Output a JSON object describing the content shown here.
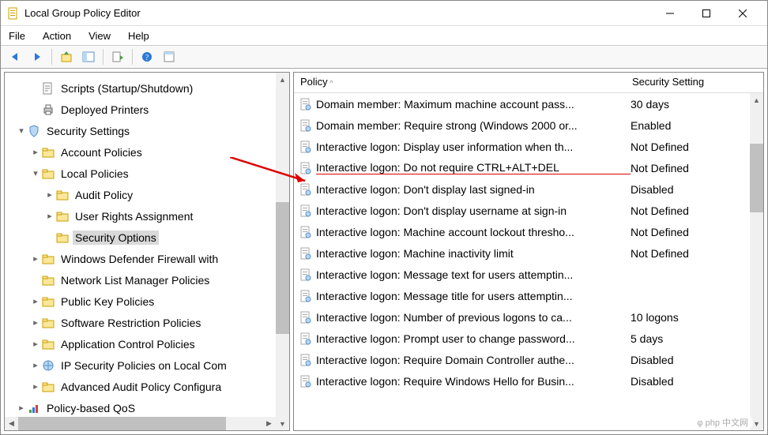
{
  "window": {
    "title": "Local Group Policy Editor"
  },
  "menubar": [
    "File",
    "Action",
    "View",
    "Help"
  ],
  "tree": [
    {
      "indent": 0,
      "chev": "",
      "icon": "script",
      "label": "Scripts (Startup/Shutdown)",
      "sel": false
    },
    {
      "indent": 0,
      "chev": "",
      "icon": "printer",
      "label": "Deployed Printers",
      "sel": false
    },
    {
      "indent": -1,
      "chev": "v",
      "icon": "shield",
      "label": "Security Settings",
      "sel": false
    },
    {
      "indent": 0,
      "chev": ">",
      "icon": "folder",
      "label": "Account Policies",
      "sel": false
    },
    {
      "indent": 0,
      "chev": "v",
      "icon": "folder",
      "label": "Local Policies",
      "sel": false
    },
    {
      "indent": 1,
      "chev": ">",
      "icon": "folder",
      "label": "Audit Policy",
      "sel": false
    },
    {
      "indent": 1,
      "chev": ">",
      "icon": "folder",
      "label": "User Rights Assignment",
      "sel": false
    },
    {
      "indent": 1,
      "chev": "",
      "icon": "folder",
      "label": "Security Options",
      "sel": true
    },
    {
      "indent": 0,
      "chev": ">",
      "icon": "folder",
      "label": "Windows Defender Firewall with",
      "sel": false
    },
    {
      "indent": 0,
      "chev": "",
      "icon": "folder",
      "label": "Network List Manager Policies",
      "sel": false
    },
    {
      "indent": 0,
      "chev": ">",
      "icon": "folder",
      "label": "Public Key Policies",
      "sel": false
    },
    {
      "indent": 0,
      "chev": ">",
      "icon": "folder",
      "label": "Software Restriction Policies",
      "sel": false
    },
    {
      "indent": 0,
      "chev": ">",
      "icon": "folder",
      "label": "Application Control Policies",
      "sel": false
    },
    {
      "indent": 0,
      "chev": ">",
      "icon": "ipsec",
      "label": "IP Security Policies on Local Com",
      "sel": false
    },
    {
      "indent": 0,
      "chev": ">",
      "icon": "folder",
      "label": "Advanced Audit Policy Configura",
      "sel": false
    },
    {
      "indent": -1,
      "chev": ">",
      "icon": "qos",
      "label": "Policy-based QoS",
      "sel": false
    }
  ],
  "list": {
    "columns": [
      "Policy",
      "Security Setting"
    ],
    "rows": [
      {
        "policy": "Domain member: Maximum machine account pass...",
        "setting": "30 days",
        "hl": false
      },
      {
        "policy": "Domain member: Require strong (Windows 2000 or...",
        "setting": "Enabled",
        "hl": false
      },
      {
        "policy": "Interactive logon: Display user information when th...",
        "setting": "Not Defined",
        "hl": false
      },
      {
        "policy": "Interactive logon: Do not require CTRL+ALT+DEL",
        "setting": "Not Defined",
        "hl": true
      },
      {
        "policy": "Interactive logon: Don't display last signed-in",
        "setting": "Disabled",
        "hl": false
      },
      {
        "policy": "Interactive logon: Don't display username at sign-in",
        "setting": "Not Defined",
        "hl": false
      },
      {
        "policy": "Interactive logon: Machine account lockout thresho...",
        "setting": "Not Defined",
        "hl": false
      },
      {
        "policy": "Interactive logon: Machine inactivity limit",
        "setting": "Not Defined",
        "hl": false
      },
      {
        "policy": "Interactive logon: Message text for users attemptin...",
        "setting": "",
        "hl": false
      },
      {
        "policy": "Interactive logon: Message title for users attemptin...",
        "setting": "",
        "hl": false
      },
      {
        "policy": "Interactive logon: Number of previous logons to ca...",
        "setting": "10 logons",
        "hl": false
      },
      {
        "policy": "Interactive logon: Prompt user to change password...",
        "setting": "5 days",
        "hl": false
      },
      {
        "policy": "Interactive logon: Require Domain Controller authe...",
        "setting": "Disabled",
        "hl": false
      },
      {
        "policy": "Interactive logon: Require Windows Hello for Busin...",
        "setting": "Disabled",
        "hl": false
      }
    ]
  },
  "watermark": "php 中文网"
}
